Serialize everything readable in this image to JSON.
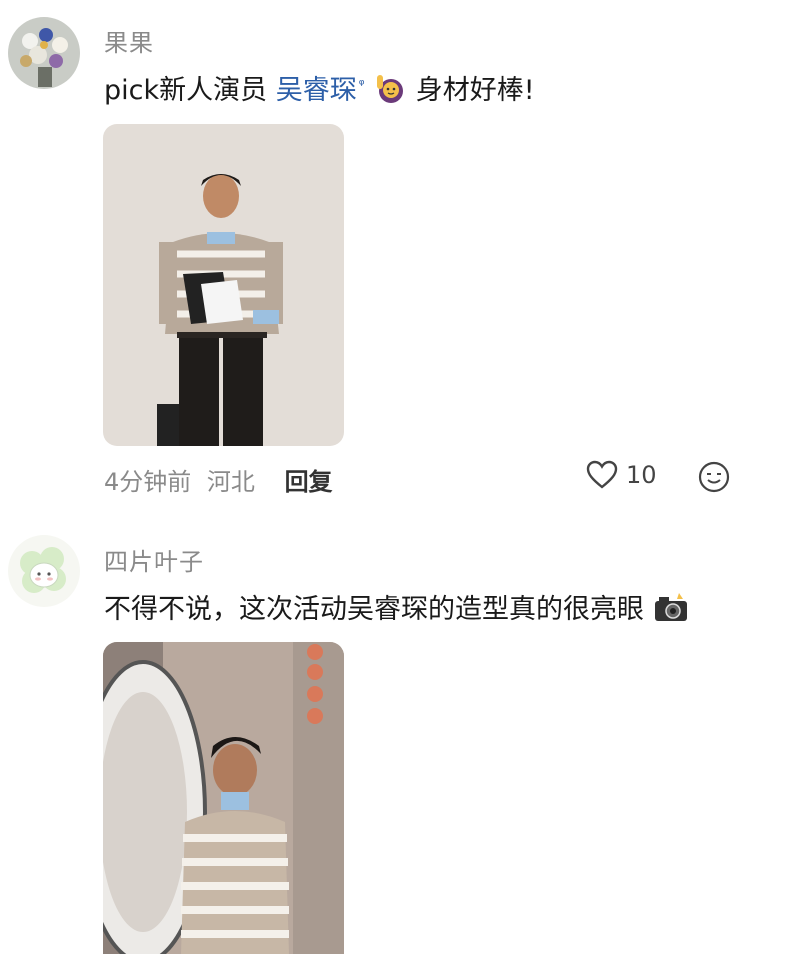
{
  "comments": [
    {
      "username": "果果",
      "text_before": "pick新人演员 ",
      "mention": "吴睿琛",
      "text_after": " 身材好棒!",
      "time": "4分钟前",
      "location": "河北",
      "reply_label": "回复",
      "likes": "10",
      "icons": [
        "avatar-flower-bouquet",
        "woman-raising-hand-emoji",
        "heart-icon",
        "emoji-reaction-icon"
      ]
    },
    {
      "username": "四片叶子",
      "text": "不得不说，这次活动吴睿琛的造型真的很亮眼",
      "icons": [
        "avatar-clover-bunny",
        "camera-flash-emoji"
      ]
    }
  ],
  "colors": {
    "username": "#8a8a8a",
    "mention": "#2d5fa8",
    "text": "#1a1a1a"
  }
}
